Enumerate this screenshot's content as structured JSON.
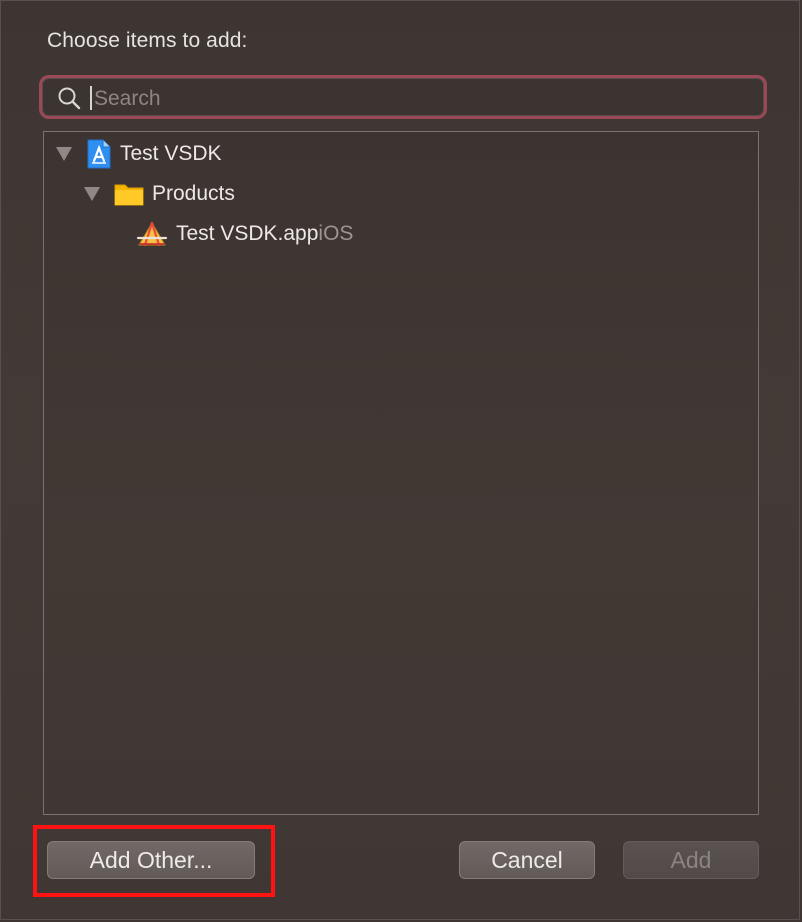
{
  "dialog": {
    "prompt": "Choose items to add:"
  },
  "search": {
    "placeholder": "Search",
    "value": ""
  },
  "tree": {
    "project": {
      "label": "Test VSDK",
      "expanded": true,
      "icon": "xcode-project-icon"
    },
    "group": {
      "label": "Products",
      "expanded": true,
      "icon": "folder-icon"
    },
    "product": {
      "label": "Test VSDK.app",
      "platform": "iOS",
      "icon": "app-product-icon"
    }
  },
  "buttons": {
    "add_other": "Add Other...",
    "cancel": "Cancel",
    "add": "Add",
    "add_enabled": false
  },
  "annotation": {
    "highlight_color": "#ff1212",
    "highlight_target": "add_other"
  }
}
